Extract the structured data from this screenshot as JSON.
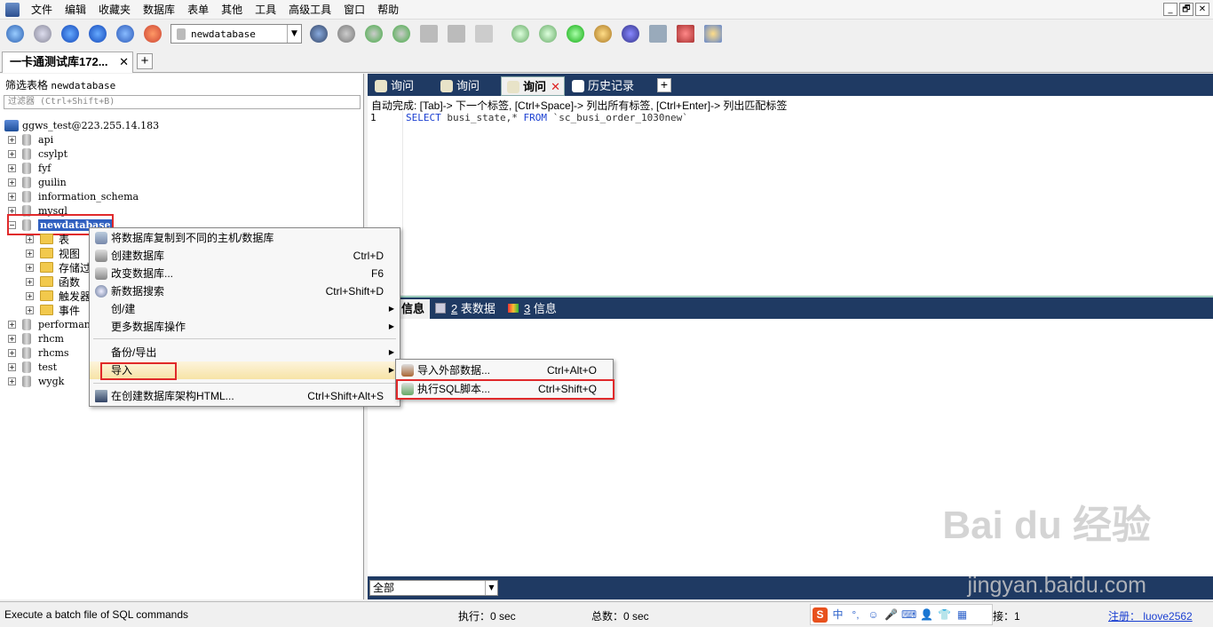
{
  "menu": [
    "文件",
    "编辑",
    "收藏夹",
    "数据库",
    "表单",
    "其他",
    "工具",
    "高级工具",
    "窗口",
    "帮助"
  ],
  "window_buttons": [
    "_",
    "🗗",
    "✕"
  ],
  "toolbar": {
    "database_select": "newdatabase",
    "select_arrow": "▼"
  },
  "connection_tab": {
    "label": "一卡通测试库172...",
    "close": "✕",
    "add": "+"
  },
  "left": {
    "filter_label": "筛选表格",
    "filter_db": "newdatabase",
    "filter_placeholder": "过滤器 (Ctrl+Shift+B)",
    "server": "ggws_test@223.255.14.183",
    "databases": [
      "api",
      "csylpt",
      "fyf",
      "guilin",
      "information_schema",
      "mysql",
      "newdatabase",
      "performan",
      "rhcm",
      "rhcms",
      "test",
      "wygk"
    ],
    "children": [
      "表",
      "视图",
      "存储过",
      "函数",
      "触发器",
      "事件"
    ],
    "expand_plus": "+",
    "expand_minus": "−"
  },
  "query_tabs": [
    {
      "label": "询问",
      "icon": "query-icon"
    },
    {
      "label": "询问",
      "icon": "query-icon"
    },
    {
      "label": "询问",
      "icon": "query-icon",
      "close": "✕"
    },
    {
      "label": "历史记录",
      "icon": "history-icon"
    }
  ],
  "query_add": "+",
  "editor": {
    "hint": "自动完成: [Tab]-> 下一个标签, [Ctrl+Space]-> 列出所有标签, [Ctrl+Enter]-> 列出匹配标签",
    "line_no": "1",
    "kw_select": "SELECT",
    "cols": "busi_state,*",
    "kw_from": "FROM",
    "table": "`sc_busi_order_1030new`"
  },
  "result_tabs": [
    {
      "num": "",
      "label": "信息"
    },
    {
      "num": "2",
      "label": "表数据"
    },
    {
      "num": "3",
      "label": "信息"
    }
  ],
  "filter_select": "全部",
  "context_menu": [
    {
      "label": "将数据库复制到不同的主机/数据库",
      "shortcut": ""
    },
    {
      "label": "创建数据库",
      "shortcut": "Ctrl+D"
    },
    {
      "label": "改变数据库...",
      "shortcut": "F6"
    },
    {
      "label": "新数据搜索",
      "shortcut": "Ctrl+Shift+D"
    },
    {
      "label": "创/建",
      "shortcut": "",
      "arrow": "▶"
    },
    {
      "label": "更多数据库操作",
      "shortcut": "",
      "arrow": "▶"
    },
    {
      "label": "备份/导出",
      "shortcut": "",
      "arrow": "▶"
    },
    {
      "label": "导入",
      "shortcut": "",
      "arrow": "▶"
    },
    {
      "label": "在创建数据库架构HTML...",
      "shortcut": "Ctrl+Shift+Alt+S"
    }
  ],
  "submenu": [
    {
      "label": "导入外部数据...",
      "shortcut": "Ctrl+Alt+O"
    },
    {
      "label": "执行SQL脚本...",
      "shortcut": "Ctrl+Shift+Q"
    }
  ],
  "status": {
    "message": "Execute a batch file of SQL commands",
    "exec": "执行：0 sec",
    "total": "总数：0 sec",
    "conn": "连接：1",
    "register": "注册： luove2562"
  },
  "ime": [
    "S",
    "中",
    "°,",
    "☺",
    "🎤",
    "⌨",
    "👤",
    "👕",
    "▦"
  ],
  "watermark": {
    "line1": "Bai du 经验",
    "line2": "jingyan.baidu.com"
  },
  "colors": {
    "dark_tab_bar": "#1f3a63",
    "selection": "#3060c0",
    "highlight_box": "#e0292b"
  }
}
